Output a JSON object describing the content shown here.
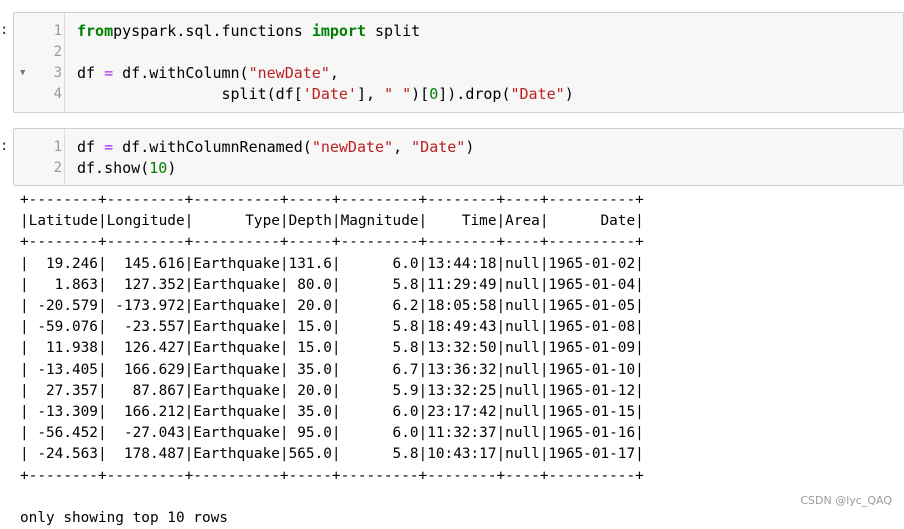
{
  "cells": [
    {
      "prompt": ":",
      "lines": [
        {
          "num": "1",
          "fold": "",
          "tokens": [
            [
              "kw",
              "from"
            ],
            [
              "",
              "pyspark.sql.functions "
            ],
            [
              "kw",
              "import"
            ],
            [
              "",
              " split"
            ]
          ]
        },
        {
          "num": "2",
          "fold": "",
          "tokens": []
        },
        {
          "num": "3",
          "fold": "▼",
          "tokens": [
            [
              "",
              "df "
            ],
            [
              "op",
              "="
            ],
            [
              "",
              " df.withColumn("
            ],
            [
              "str",
              "\"newDate\""
            ],
            [
              "",
              ","
            ]
          ]
        },
        {
          "num": "4",
          "fold": "",
          "tokens": [
            [
              "",
              "                split(df["
            ],
            [
              "str",
              "'Date'"
            ],
            [
              "",
              "], "
            ],
            [
              "str",
              "\" \""
            ],
            [
              "",
              ")["
            ],
            [
              "num",
              "0"
            ],
            [
              "",
              "]).drop("
            ],
            [
              "str",
              "\"Date\""
            ],
            [
              "",
              ")"
            ]
          ]
        }
      ]
    },
    {
      "prompt": ":",
      "lines": [
        {
          "num": "1",
          "fold": "",
          "tokens": [
            [
              "",
              "df "
            ],
            [
              "op",
              "="
            ],
            [
              "",
              " df.withColumnRenamed("
            ],
            [
              "str",
              "\"newDate\""
            ],
            [
              "",
              ", "
            ],
            [
              "str",
              "\"Date\""
            ],
            [
              "",
              ")"
            ]
          ]
        },
        {
          "num": "2",
          "fold": "",
          "tokens": [
            [
              "",
              "df.show("
            ],
            [
              "num",
              "10"
            ],
            [
              "",
              ")"
            ]
          ]
        }
      ]
    }
  ],
  "table": {
    "columns": [
      "Latitude",
      "Longitude",
      "Type",
      "Depth",
      "Magnitude",
      "Time",
      "Area",
      "Date"
    ],
    "rows": [
      [
        "19.246",
        "145.616",
        "Earthquake",
        "131.6",
        "6.0",
        "13:44:18",
        "null",
        "1965-01-02"
      ],
      [
        "1.863",
        "127.352",
        "Earthquake",
        "80.0",
        "5.8",
        "11:29:49",
        "null",
        "1965-01-04"
      ],
      [
        "-20.579",
        "-173.972",
        "Earthquake",
        "20.0",
        "6.2",
        "18:05:58",
        "null",
        "1965-01-05"
      ],
      [
        "-59.076",
        "-23.557",
        "Earthquake",
        "15.0",
        "5.8",
        "18:49:43",
        "null",
        "1965-01-08"
      ],
      [
        "11.938",
        "126.427",
        "Earthquake",
        "15.0",
        "5.8",
        "13:32:50",
        "null",
        "1965-01-09"
      ],
      [
        "-13.405",
        "166.629",
        "Earthquake",
        "35.0",
        "6.7",
        "13:36:32",
        "null",
        "1965-01-10"
      ],
      [
        "27.357",
        "87.867",
        "Earthquake",
        "20.0",
        "5.9",
        "13:32:25",
        "null",
        "1965-01-12"
      ],
      [
        "-13.309",
        "166.212",
        "Earthquake",
        "35.0",
        "6.0",
        "23:17:42",
        "null",
        "1965-01-15"
      ],
      [
        "-56.452",
        "-27.043",
        "Earthquake",
        "95.0",
        "6.0",
        "11:32:37",
        "null",
        "1965-01-16"
      ],
      [
        "-24.563",
        "178.487",
        "Earthquake",
        "565.0",
        "5.8",
        "10:43:17",
        "null",
        "1965-01-17"
      ]
    ],
    "footer": "only showing top 10 rows"
  },
  "watermark": "CSDN @lyc_QAQ"
}
